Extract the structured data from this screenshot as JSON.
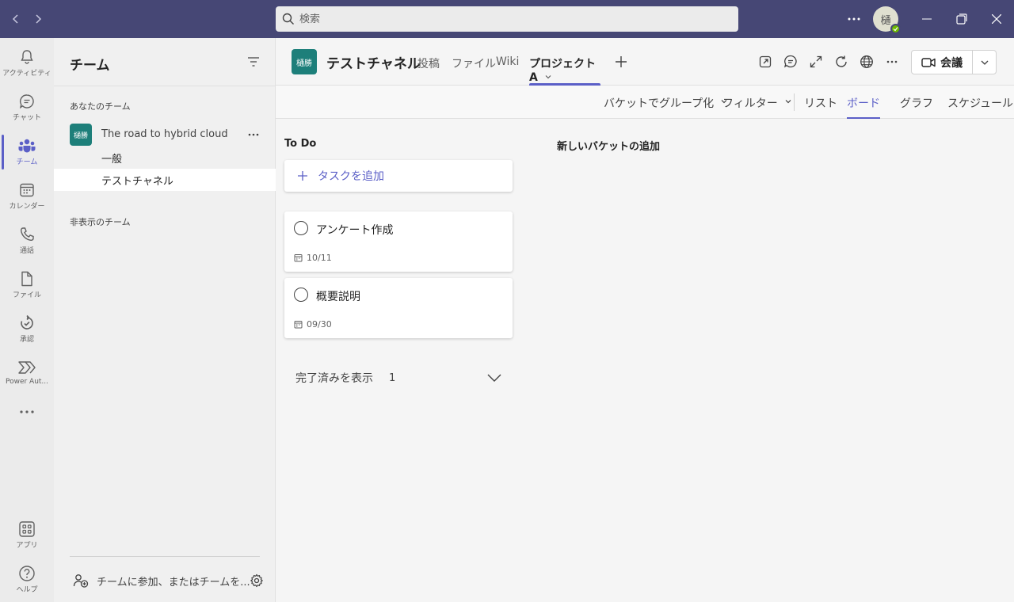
{
  "titlebar": {
    "search_placeholder": "検索",
    "avatar_initial": "樋"
  },
  "rail": {
    "items": [
      {
        "label": "アクティビティ",
        "icon": "bell-icon"
      },
      {
        "label": "チャット",
        "icon": "chat-icon"
      },
      {
        "label": "チーム",
        "icon": "teams-icon"
      },
      {
        "label": "カレンダー",
        "icon": "calendar-icon"
      },
      {
        "label": "通話",
        "icon": "phone-icon"
      },
      {
        "label": "ファイル",
        "icon": "file-icon"
      },
      {
        "label": "承認",
        "icon": "approval-icon"
      },
      {
        "label": "Power Aut...",
        "icon": "power-automate-icon"
      },
      {
        "label": "アプリ",
        "icon": "apps-icon"
      },
      {
        "label": "ヘルプ",
        "icon": "help-icon"
      }
    ]
  },
  "teams_panel": {
    "title": "チーム",
    "your_teams_label": "あなたのチーム",
    "team": {
      "avatar_text": "樋勝",
      "name": "The road to hybrid cloud",
      "channels": [
        "一般",
        "テストチャネル"
      ]
    },
    "hidden_teams_label": "非表示のチーム",
    "join_label": "チームに参加、またはチームを..."
  },
  "channel_header": {
    "avatar_text": "樋勝",
    "title": "テストチャネル",
    "tabs": [
      "投稿",
      "ファイル",
      "Wiki",
      "プロジェクトA"
    ],
    "active_tab": "プロジェクトA",
    "meet_label": "会議"
  },
  "planner": {
    "group_by_label": "バケットでグループ化",
    "filter_label": "フィルター",
    "views": [
      "リスト",
      "ボード",
      "グラフ",
      "スケジュール"
    ],
    "active_view": "ボード"
  },
  "board": {
    "bucket_name": "To Do",
    "add_task_label": "タスクを追加",
    "tasks": [
      {
        "title": "アンケート作成",
        "date": "10/11"
      },
      {
        "title": "概要説明",
        "date": "09/30"
      }
    ],
    "show_completed_label": "完了済みを表示",
    "completed_count": "1",
    "new_bucket_label": "新しいバケットの追加"
  },
  "colors": {
    "titlebar": "#464775",
    "accent": "#5b5fc7",
    "team_avatar": "#1d7f7a",
    "presence": "#6bb700"
  }
}
